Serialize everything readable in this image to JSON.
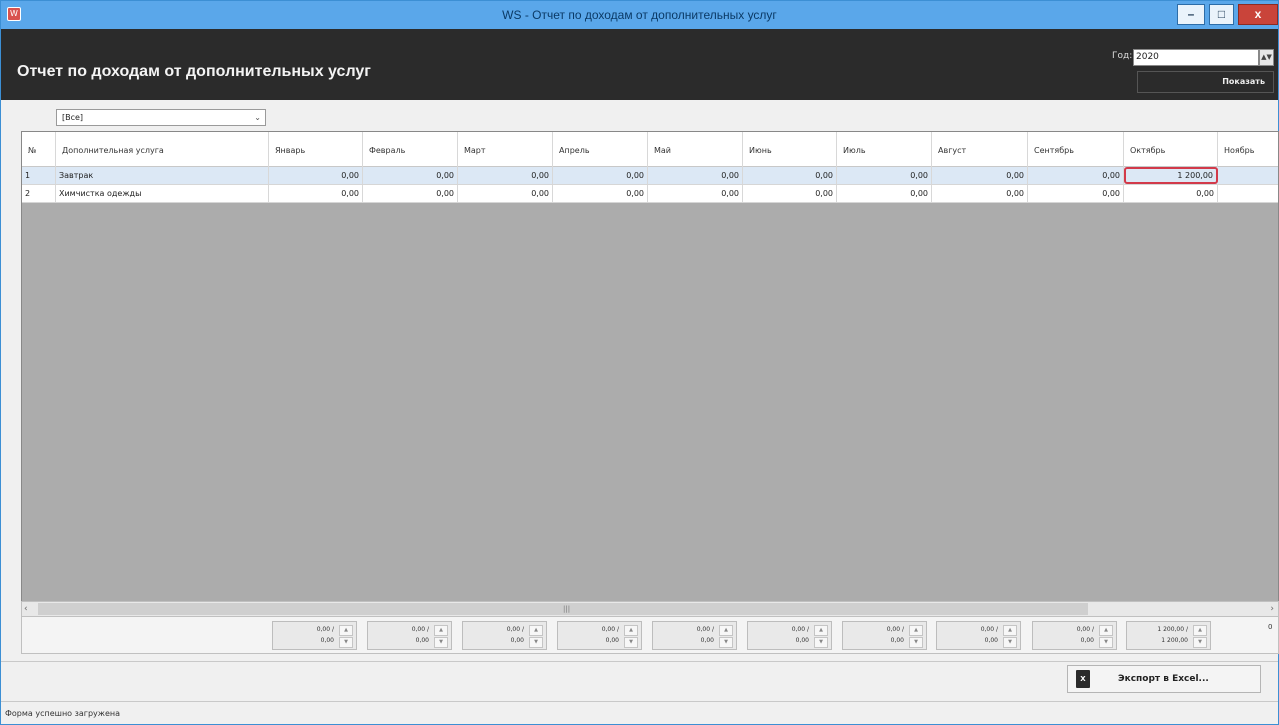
{
  "window": {
    "title": "WS - Отчет по доходам от дополнительных услуг",
    "app_icon_glyph": "W",
    "minimize_glyph": "–",
    "maximize_glyph": "□",
    "close_glyph": "x"
  },
  "header": {
    "title": "Отчет по доходам от дополнительных услуг",
    "year_label": "Год:",
    "year_value": "2020",
    "show_label": "Показать"
  },
  "filter": {
    "value": "[Все]"
  },
  "table": {
    "columns": [
      "№",
      "Дополнительная услуга",
      "Январь",
      "Февраль",
      "Март",
      "Апрель",
      "Май",
      "Июнь",
      "Июль",
      "Август",
      "Сентябрь",
      "Октябрь",
      "Ноябрь"
    ],
    "rows": [
      {
        "num": "1",
        "service": "Завтрак",
        "values": [
          "0,00",
          "0,00",
          "0,00",
          "0,00",
          "0,00",
          "0,00",
          "0,00",
          "0,00",
          "0,00",
          "1 200,00"
        ],
        "selected": true
      },
      {
        "num": "2",
        "service": "Химчистка одежды",
        "values": [
          "0,00",
          "0,00",
          "0,00",
          "0,00",
          "0,00",
          "0,00",
          "0,00",
          "0,00",
          "0,00",
          "0,00"
        ],
        "selected": false
      }
    ]
  },
  "totals": [
    {
      "line1": "0,00 /",
      "line2": "0,00"
    },
    {
      "line1": "0,00 /",
      "line2": "0,00"
    },
    {
      "line1": "0,00 /",
      "line2": "0,00"
    },
    {
      "line1": "0,00 /",
      "line2": "0,00"
    },
    {
      "line1": "0,00 /",
      "line2": "0,00"
    },
    {
      "line1": "0,00 /",
      "line2": "0,00"
    },
    {
      "line1": "0,00 /",
      "line2": "0,00"
    },
    {
      "line1": "0,00 /",
      "line2": "0,00"
    },
    {
      "line1": "0,00 /",
      "line2": "0,00"
    },
    {
      "line1": "1 200,00 /",
      "line2": "1 200,00"
    }
  ],
  "totals_trailing": "0",
  "export_label": "Экспорт в Excel...",
  "status_text": "Форма успешно загружена",
  "colors": {
    "titlebar": "#5aa7ea",
    "header_bg": "#2b2b2b",
    "grid_bg": "#acacac",
    "selected_row": "#dce8f5",
    "highlight_border": "#d23a4a"
  },
  "icons": {
    "app": "app-logo-icon",
    "year_spin": "spin-updown-icon",
    "filter": "chevron-down-icon",
    "scroll_left": "chevron-left-icon",
    "scroll_right": "chevron-right-icon",
    "excel": "excel-file-icon"
  }
}
